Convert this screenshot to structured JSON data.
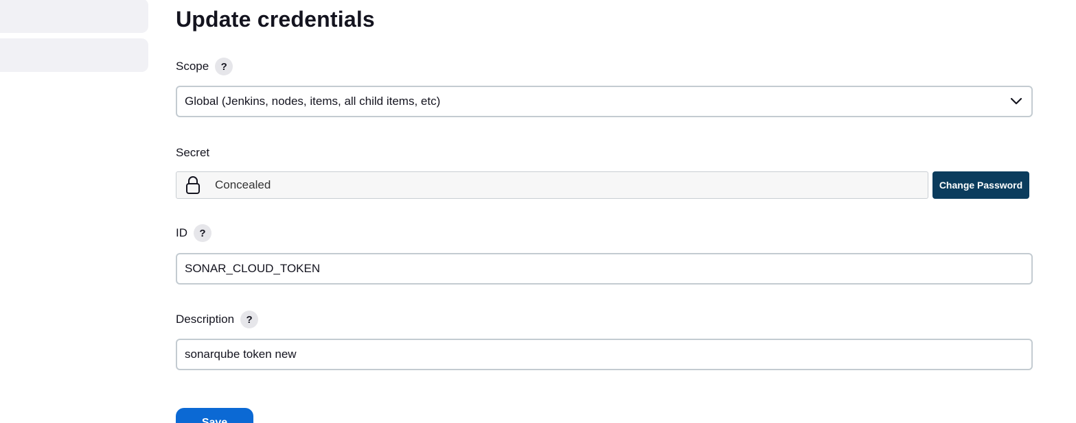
{
  "page": {
    "title": "Update credentials"
  },
  "form": {
    "scope": {
      "label": "Scope",
      "help": "?",
      "selected": "Global (Jenkins, nodes, items, all child items, etc)"
    },
    "secret": {
      "label": "Secret",
      "value": "Concealed",
      "change_button": "Change Password"
    },
    "id": {
      "label": "ID",
      "help": "?",
      "value": "SONAR_CLOUD_TOKEN"
    },
    "description": {
      "label": "Description",
      "help": "?",
      "value": "sonarqube token new"
    },
    "save_button": "Save"
  },
  "icons": {
    "scope_dropdown": "chevron-down-icon",
    "secret": "lock-icon"
  },
  "colors": {
    "primary_button": "#0b69d4",
    "secondary_button": "#0b3c5d",
    "field_border": "#c3cbd1",
    "sidebar_item": "#f1f1f5"
  }
}
